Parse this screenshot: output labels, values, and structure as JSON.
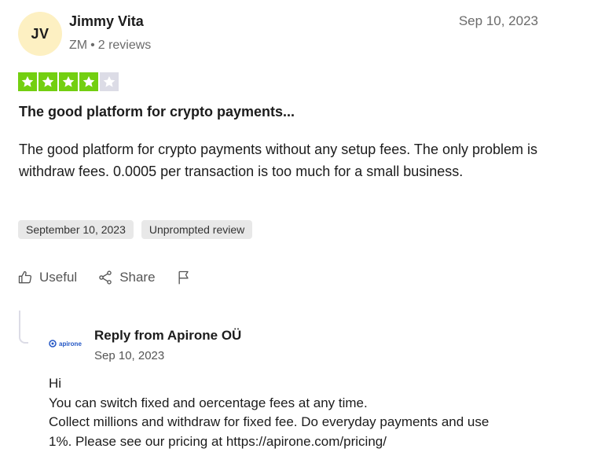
{
  "reviewer": {
    "initials": "JV",
    "name": "Jimmy Vita",
    "country": "ZM",
    "reviews": "2 reviews",
    "date": "Sep 10, 2023"
  },
  "rating": {
    "value": 4,
    "max": 5,
    "filled_color": "#73cf11",
    "empty_color": "#dcdce6"
  },
  "review": {
    "title": "The good platform for crypto payments...",
    "body": "The good platform for crypto payments without any setup fees. The only problem is withdraw fees. 0.0005 per transaction is too much for a small business."
  },
  "tags": [
    "September 10, 2023",
    "Unprompted review"
  ],
  "actions": {
    "useful": "Useful",
    "share": "Share"
  },
  "reply": {
    "logo_text": "apirone",
    "title": "Reply from Apirone OÜ",
    "date": "Sep 10, 2023",
    "lines": [
      "Hi",
      "You can switch fixed and oercentage fees at any time.",
      "Collect millions and withdraw for fixed fee. Do everyday payments and use",
      "1%. Please see our pricing at https://apirone.com/pricing/"
    ]
  }
}
